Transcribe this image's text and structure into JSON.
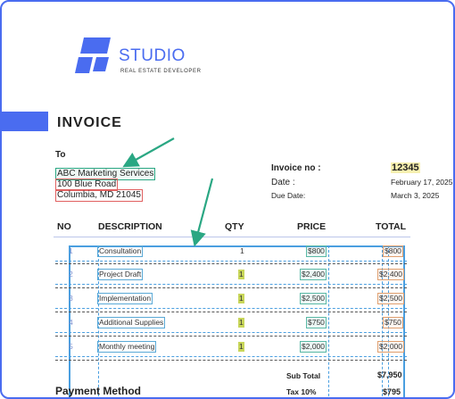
{
  "brand": {
    "name": "STUDIO",
    "tagline": "REAL ESTATE DEVELOPER",
    "color": "#4a6cf0"
  },
  "invoice": {
    "title": "INVOICE"
  },
  "bill_to": {
    "label": "To",
    "lines": [
      "ABC Marketing Services",
      "100 Blue Road",
      "Columbia, MD 21045"
    ]
  },
  "meta": {
    "invoice_no_label": "Invoice no :",
    "invoice_no": "12345",
    "date_label": "Date :",
    "date": "February 17, 2025",
    "due_label": "Due Date:",
    "due": "March 3, 2025"
  },
  "table": {
    "headers": {
      "no": "NO",
      "description": "DESCRIPTION",
      "qty": "QTY",
      "price": "PRICE",
      "total": "TOTAL"
    },
    "rows": [
      {
        "no": "1",
        "description": "Consultation",
        "qty": "1",
        "price": "$800",
        "total": "$800"
      },
      {
        "no": "2",
        "description": "Project Draft",
        "qty": "1",
        "price": "$2,400",
        "total": "$2,400"
      },
      {
        "no": "3",
        "description": "Implementation",
        "qty": "1",
        "price": "$2,500",
        "total": "$2,500"
      },
      {
        "no": "4",
        "description": "Additional Supplies",
        "qty": "1",
        "price": "$750",
        "total": "$750"
      },
      {
        "no": "5",
        "description": "Monthly meeting",
        "qty": "1",
        "price": "$2,000",
        "total": "$2,000"
      }
    ]
  },
  "summary": {
    "subtotal_label": "Sub Total",
    "subtotal": "$7,950",
    "tax_label": "Tax 10%",
    "tax": "$795"
  },
  "payment": {
    "heading": "Payment Method"
  }
}
